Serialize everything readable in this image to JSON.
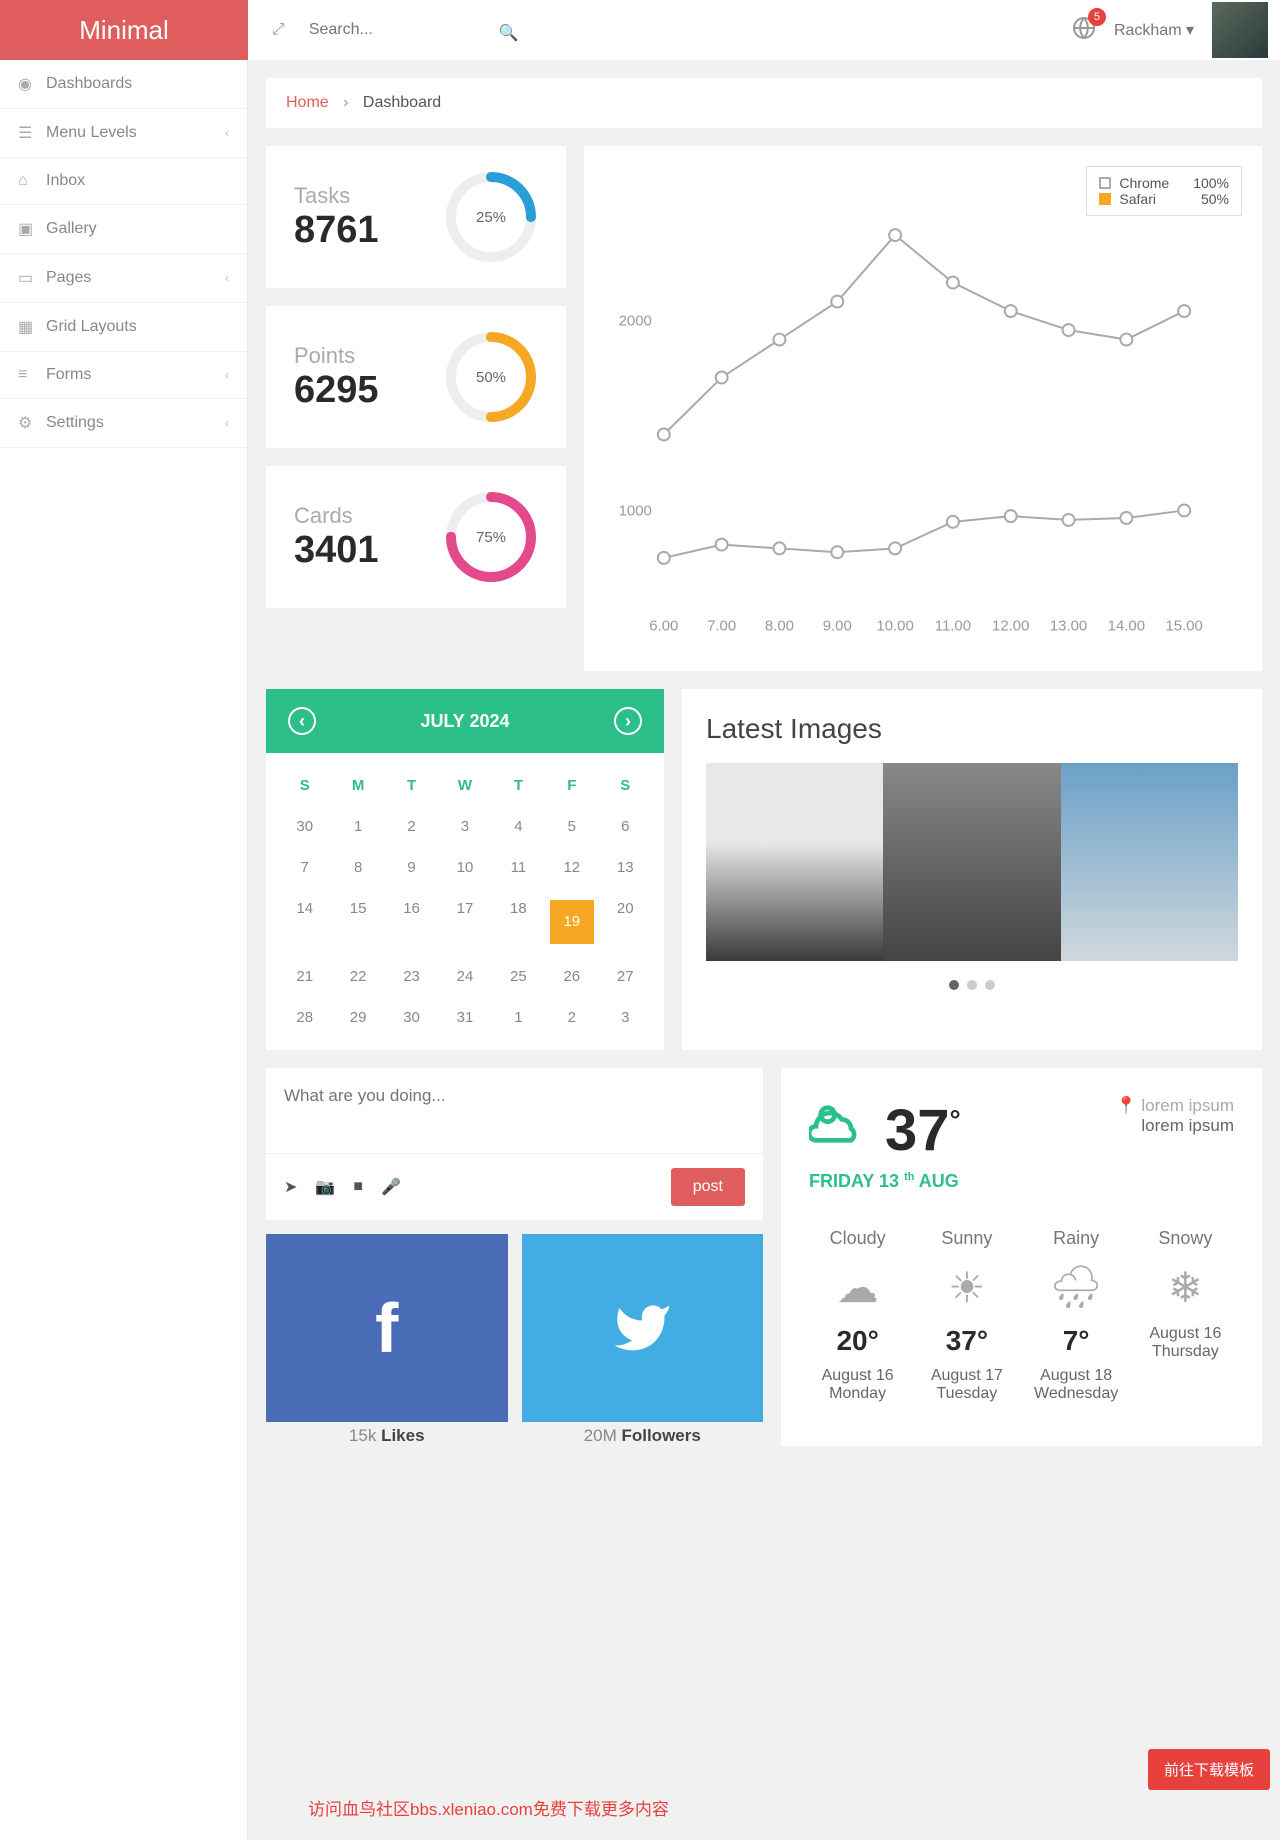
{
  "brand": "Minimal",
  "search": {
    "placeholder": "Search..."
  },
  "notifications": {
    "count": "5"
  },
  "user": {
    "name": "Rackham"
  },
  "sidebar": {
    "items": [
      {
        "label": "Dashboards",
        "icon": "dashboard",
        "sub": false
      },
      {
        "label": "Menu Levels",
        "icon": "menu",
        "sub": true
      },
      {
        "label": "Inbox",
        "icon": "inbox",
        "sub": false
      },
      {
        "label": "Gallery",
        "icon": "image",
        "sub": false
      },
      {
        "label": "Pages",
        "icon": "display",
        "sub": true
      },
      {
        "label": "Grid Layouts",
        "icon": "grid",
        "sub": false
      },
      {
        "label": "Forms",
        "icon": "list",
        "sub": true
      },
      {
        "label": "Settings",
        "icon": "gear",
        "sub": true
      }
    ]
  },
  "breadcrumb": {
    "home": "Home",
    "current": "Dashboard"
  },
  "stats": [
    {
      "label": "Tasks",
      "value": "8761",
      "pct": "25%",
      "color": "#2a9fd6"
    },
    {
      "label": "Points",
      "value": "6295",
      "pct": "50%",
      "color": "#f6a724"
    },
    {
      "label": "Cards",
      "value": "3401",
      "pct": "75%",
      "color": "#e44a8b"
    }
  ],
  "chart_data": {
    "type": "line",
    "ylabel": "",
    "xlabel": "",
    "yticks": [
      1000,
      2000
    ],
    "categories": [
      "6.00",
      "7.00",
      "8.00",
      "9.00",
      "10.00",
      "11.00",
      "12.00",
      "13.00",
      "14.00",
      "15.00"
    ],
    "series": [
      {
        "name": "Chrome",
        "pct": "100%",
        "color": "#aaaaaa",
        "values": [
          1400,
          1700,
          1900,
          2100,
          2450,
          2200,
          2050,
          1950,
          1900,
          2050
        ]
      },
      {
        "name": "Safari",
        "pct": "50%",
        "color": "#f6a724",
        "values": [
          750,
          820,
          800,
          780,
          800,
          940,
          970,
          950,
          960,
          1000
        ]
      }
    ],
    "legend": [
      {
        "name": "Chrome",
        "pct": "100%",
        "color": "#aaaaaa"
      },
      {
        "name": "Safari",
        "pct": "50%",
        "color": "#f6a724"
      }
    ]
  },
  "calendar": {
    "title": "JULY 2024",
    "days": [
      "S",
      "M",
      "T",
      "W",
      "T",
      "F",
      "S"
    ],
    "weeks": [
      [
        "30",
        "1",
        "2",
        "3",
        "4",
        "5",
        "6"
      ],
      [
        "7",
        "8",
        "9",
        "10",
        "11",
        "12",
        "13"
      ],
      [
        "14",
        "15",
        "16",
        "17",
        "18",
        "19",
        "20"
      ],
      [
        "21",
        "22",
        "23",
        "24",
        "25",
        "26",
        "27"
      ],
      [
        "28",
        "29",
        "30",
        "31",
        "1",
        "2",
        "3"
      ]
    ],
    "today": "19"
  },
  "images": {
    "title": "Latest Images"
  },
  "post": {
    "placeholder": "What are you doing...",
    "button": "post"
  },
  "social": {
    "fb": {
      "count": "15k",
      "label": "Likes"
    },
    "tw": {
      "count": "20M",
      "label": "Followers"
    }
  },
  "weather": {
    "current": {
      "temp": "37",
      "deg": "°",
      "loc1": "lorem ipsum",
      "loc2": "lorem ipsum",
      "day": "FRIDAY 13",
      "th": "th",
      "month": "AUG"
    },
    "forecast": [
      {
        "cond": "Cloudy",
        "temp": "20°",
        "date": "August 16",
        "dow": "Monday"
      },
      {
        "cond": "Sunny",
        "temp": "37°",
        "date": "August 17",
        "dow": "Tuesday"
      },
      {
        "cond": "Rainy",
        "temp": "7°",
        "date": "August 18",
        "dow": "Wednesday"
      },
      {
        "cond": "Snowy",
        "temp": "",
        "date": "August 16",
        "dow": "Thursday"
      }
    ]
  },
  "download_button": "前往下载模板",
  "watermark": "访问血鸟社区bbs.xleniao.com免费下载更多内容"
}
